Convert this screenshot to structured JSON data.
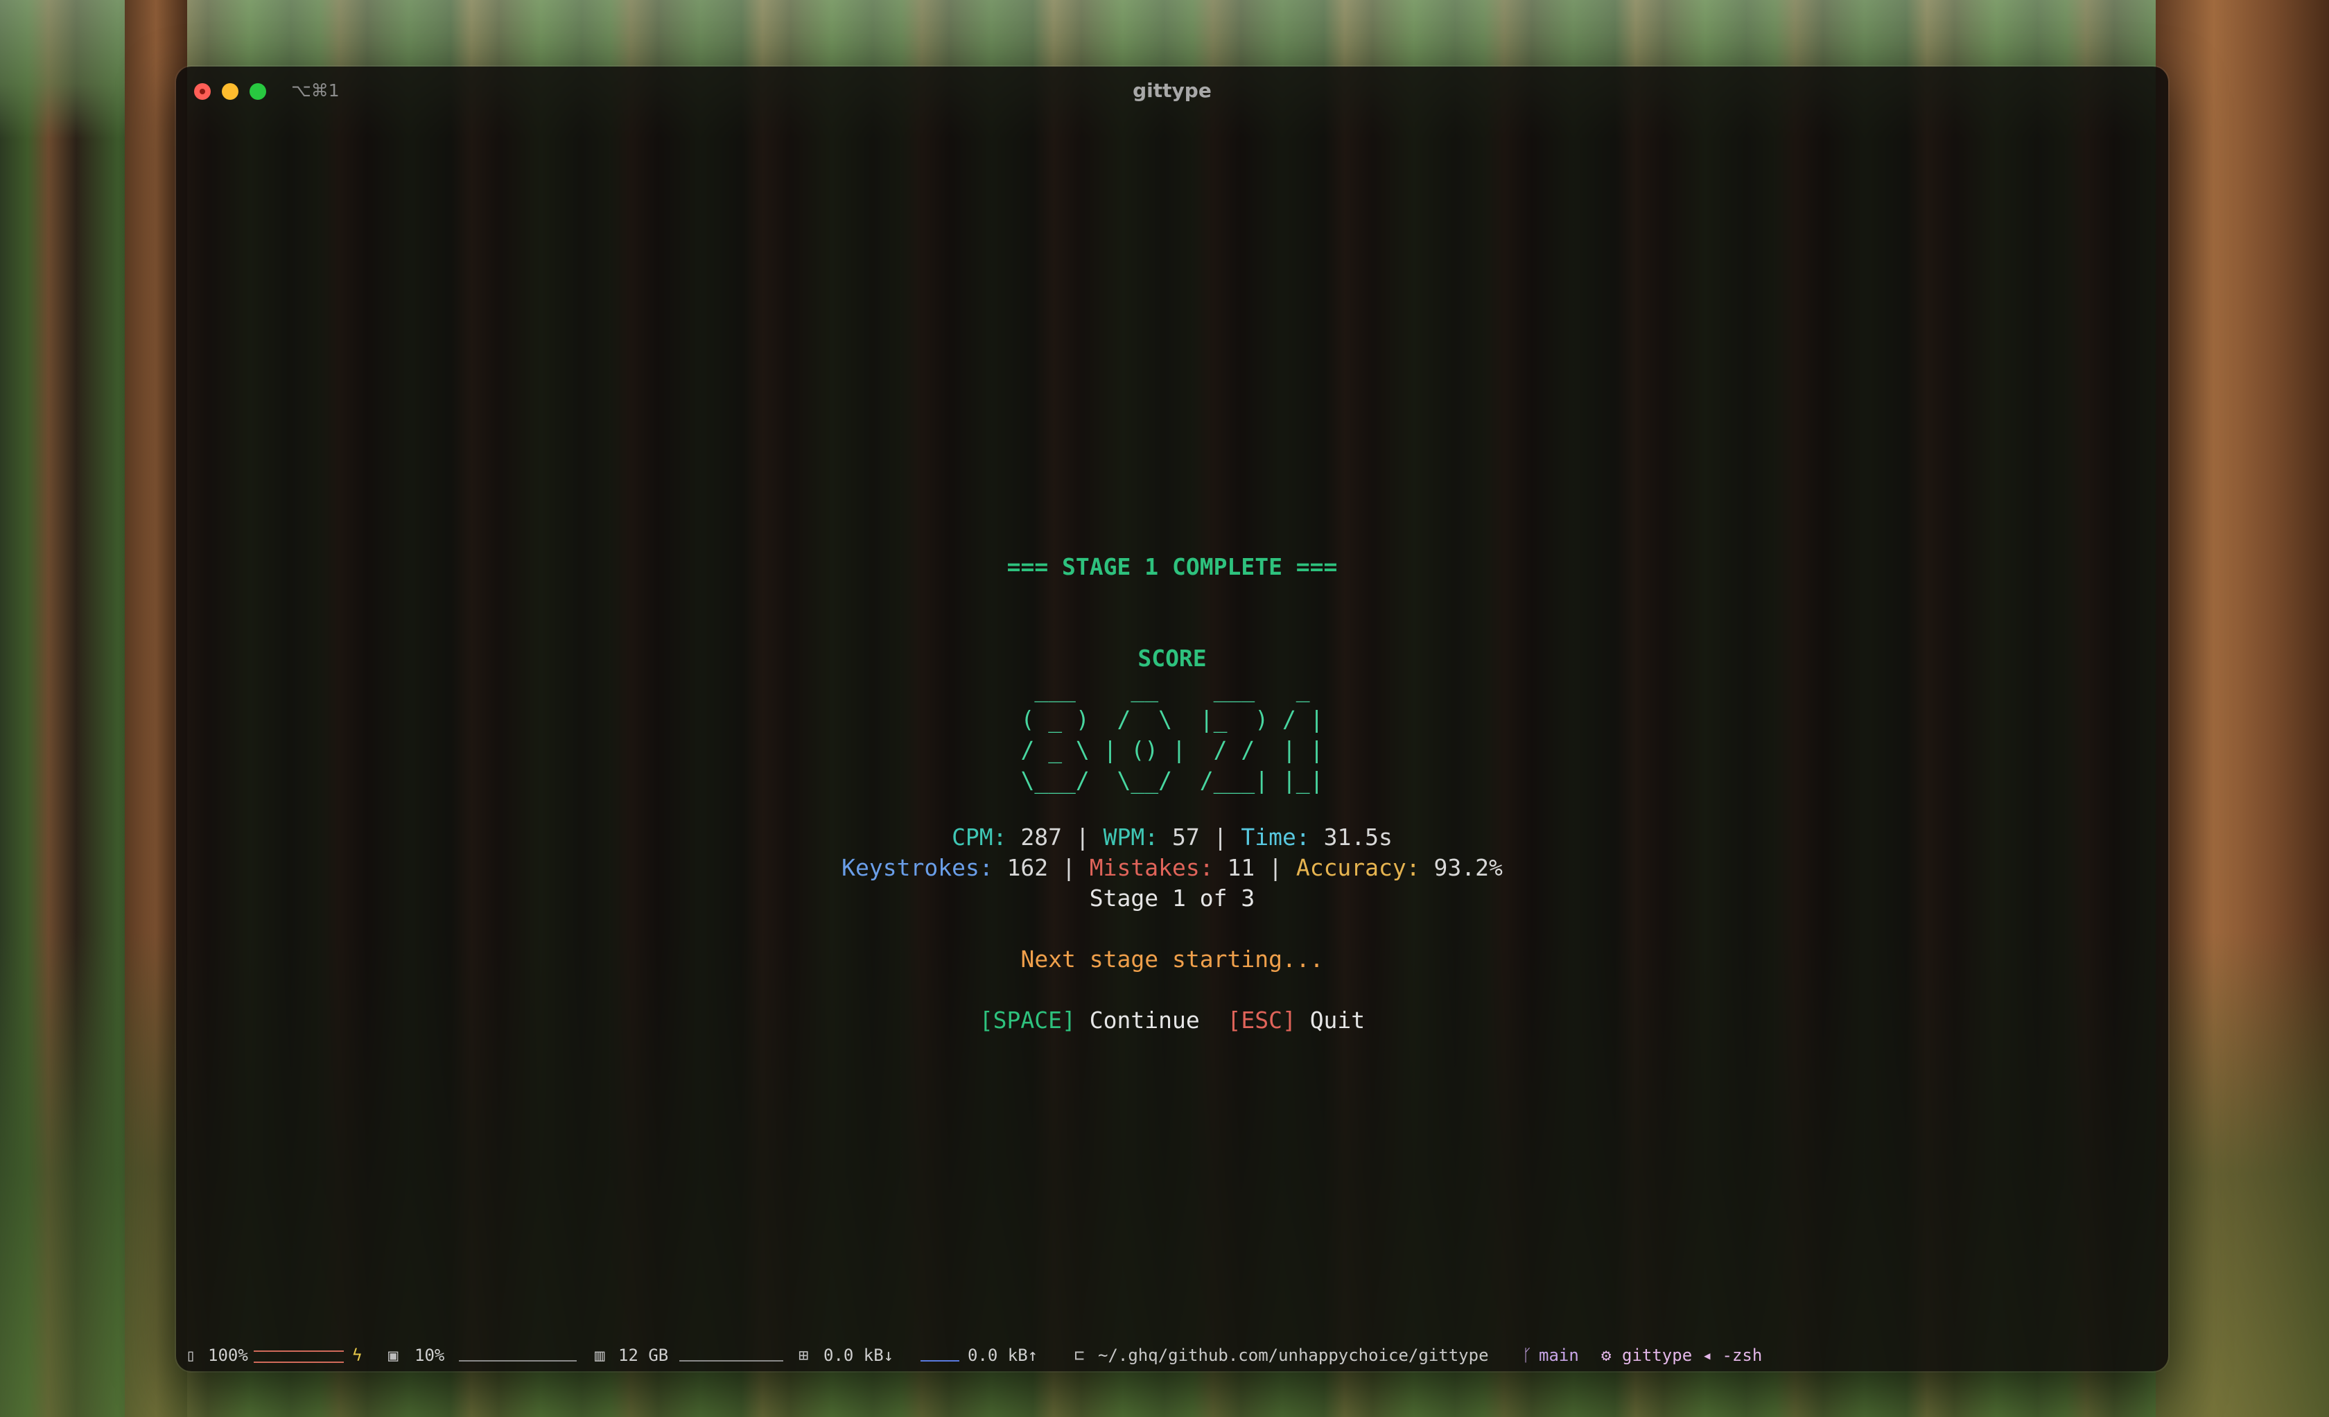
{
  "window": {
    "shortcut": "⌥⌘1",
    "title": "gittype"
  },
  "result": {
    "header": "=== STAGE 1 COMPLETE ===",
    "score_label": "SCORE",
    "score_ascii": [
      " ___    __    ___   _ ",
      "( _ )  /  \\  |_  ) / |",
      "/ _ \\ | () |  / /  | |",
      "\\___/  \\__/  /___| |_|"
    ],
    "score_value": "8021",
    "stats1": {
      "cpm_label": "CPM:",
      "cpm": "287",
      "wpm_label": "WPM:",
      "wpm": "57",
      "time_label": "Time:",
      "time": "31.5s",
      "sep": " | "
    },
    "stats2": {
      "keystrokes_label": "Keystrokes:",
      "keystrokes": "162",
      "mistakes_label": "Mistakes:",
      "mistakes": "11",
      "accuracy_label": "Accuracy:",
      "accuracy": "93.2%",
      "sep": " | "
    },
    "stage_progress": "Stage 1 of 3",
    "next_msg": "Next stage starting...",
    "controls": {
      "space_key": "[SPACE]",
      "space_action": "Continue",
      "esc_key": "[ESC]",
      "esc_action": "Quit"
    }
  },
  "statusbar": {
    "battery": "100%",
    "battery_icon": "battery-icon",
    "cpu": "10%",
    "cpu_icon": "cpu-icon",
    "memory": "12 GB",
    "memory_icon": "memory-icon",
    "net_down": "0.0 kB↓",
    "net_up": "0.0 kB↑",
    "path": "~/.ghq/github.com/unhappychoice/gittype",
    "branch": "main",
    "process": "gittype ◂ -zsh"
  }
}
